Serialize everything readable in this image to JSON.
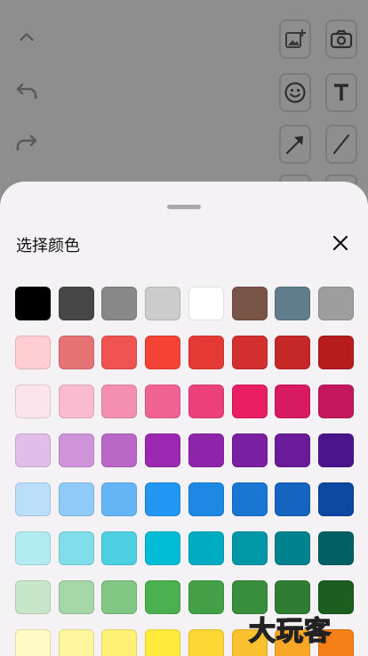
{
  "sheet": {
    "title": "选择颜色"
  },
  "watermark": "大玩客",
  "colors": [
    [
      "#000000",
      "#474747",
      "#888888",
      "#cccccc",
      "#ffffff",
      "#795548",
      "#607d8b",
      "#9e9e9e"
    ],
    [
      "#ffcdd2",
      "#e57373",
      "#ef5350",
      "#f44336",
      "#e53935",
      "#d32f2f",
      "#c62828",
      "#b71c1c"
    ],
    [
      "#fce4ec",
      "#f8bbd0",
      "#f48fb1",
      "#f06292",
      "#ec407a",
      "#e91e63",
      "#d81b60",
      "#c2185b"
    ],
    [
      "#e1bee7",
      "#ce93d8",
      "#ba68c8",
      "#9c27b0",
      "#8e24aa",
      "#7b1fa2",
      "#6a1b9a",
      "#4a148c"
    ],
    [
      "#bbdefb",
      "#90caf9",
      "#64b5f6",
      "#2196f3",
      "#1e88e5",
      "#1976d2",
      "#1565c0",
      "#0d47a1"
    ],
    [
      "#b2ebf2",
      "#80deea",
      "#4dd0e1",
      "#00bcd4",
      "#00acc1",
      "#0097a7",
      "#00838f",
      "#006064"
    ],
    [
      "#c8e6c9",
      "#a5d6a7",
      "#81c784",
      "#4caf50",
      "#43a047",
      "#388e3c",
      "#2e7d32",
      "#1b5e20"
    ],
    [
      "#fff9c4",
      "#fff59d",
      "#fff176",
      "#ffeb3b",
      "#fdd835",
      "#fbc02d",
      "#f9a825",
      "#f57f17"
    ]
  ]
}
